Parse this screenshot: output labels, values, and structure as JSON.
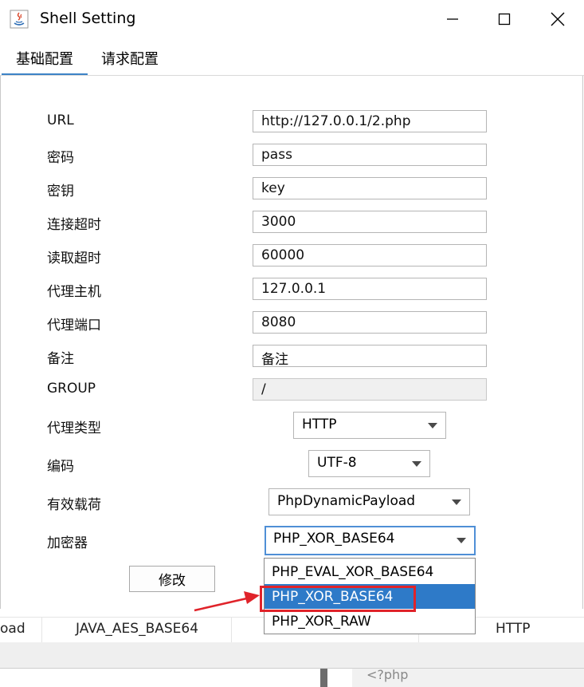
{
  "window": {
    "title": "Shell Setting"
  },
  "tabs": [
    {
      "label": "基础配置"
    },
    {
      "label": "请求配置"
    }
  ],
  "form": {
    "fields": [
      {
        "label": "URL",
        "value": "http://127.0.0.1/2.php"
      },
      {
        "label": "密码",
        "value": "pass"
      },
      {
        "label": "密钥",
        "value": "key"
      },
      {
        "label": "连接超时",
        "value": "3000"
      },
      {
        "label": "读取超时",
        "value": "60000"
      },
      {
        "label": "代理主机",
        "value": "127.0.0.1"
      },
      {
        "label": "代理端口",
        "value": "8080"
      },
      {
        "label": "备注",
        "value": "备注"
      },
      {
        "label": "GROUP",
        "value": "/"
      }
    ],
    "selects": [
      {
        "label": "代理类型",
        "value": "HTTP"
      },
      {
        "label": "编码",
        "value": "UTF-8"
      },
      {
        "label": "有效载荷",
        "value": "PhpDynamicPayload"
      },
      {
        "label": "加密器",
        "value": "PHP_XOR_BASE64"
      }
    ],
    "modify_button": "修改"
  },
  "dropdown": {
    "options": [
      "PHP_EVAL_XOR_BASE64",
      "PHP_XOR_BASE64",
      "PHP_XOR_RAW"
    ],
    "selected_index": 1
  },
  "background": {
    "row": [
      "oad",
      "JAVA_AES_BASE64",
      "HTTP"
    ],
    "code_preview": "<?php"
  },
  "colors": {
    "accent": "#2e7ac8",
    "highlight": "#e0232a",
    "tab_underline": "#3d83c6"
  }
}
